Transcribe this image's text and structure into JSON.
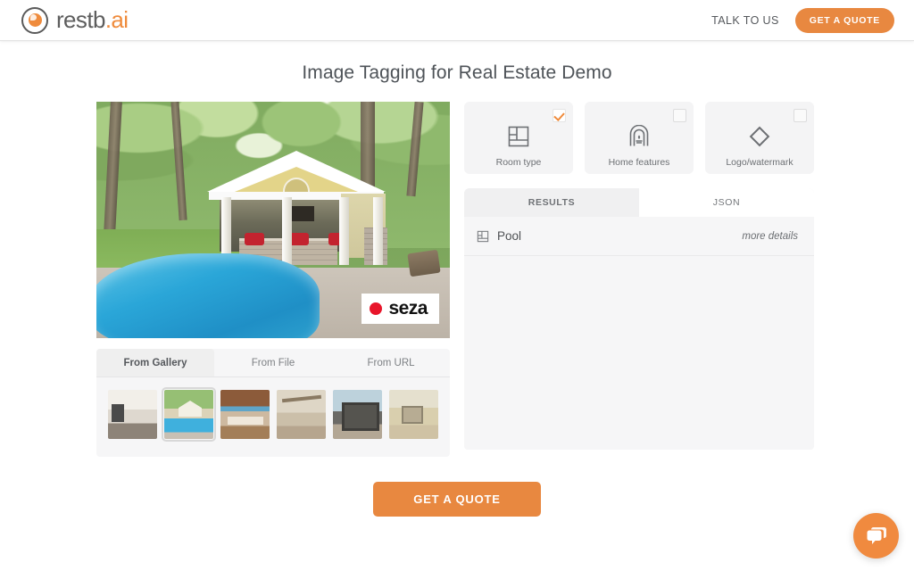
{
  "header": {
    "brand_name": "restb",
    "brand_suffix": ".ai",
    "talk_link": "TALK TO US",
    "quote_button": "GET A QUOTE"
  },
  "page": {
    "title": "Image Tagging for Real Estate Demo"
  },
  "hero": {
    "watermark_text": "seza"
  },
  "source": {
    "tabs": [
      {
        "label": "From Gallery",
        "active": true
      },
      {
        "label": "From File",
        "active": false
      },
      {
        "label": "From URL",
        "active": false
      }
    ],
    "thumbnails": [
      {
        "name": "living-room",
        "selected": false
      },
      {
        "name": "pool-pavilion",
        "selected": true
      },
      {
        "name": "kitchen",
        "selected": false
      },
      {
        "name": "dining-room",
        "selected": false
      },
      {
        "name": "hot-tub",
        "selected": false
      },
      {
        "name": "bedroom",
        "selected": false
      }
    ]
  },
  "models": [
    {
      "label": "Room type",
      "icon": "floorplan-icon",
      "checked": true
    },
    {
      "label": "Home features",
      "icon": "fireplace-icon",
      "checked": false
    },
    {
      "label": "Logo/watermark",
      "icon": "diamond-icon",
      "checked": false
    }
  ],
  "results": {
    "tabs": [
      {
        "label": "RESULTS",
        "selected": false
      },
      {
        "label": "JSON",
        "selected": true
      }
    ],
    "rows": [
      {
        "icon": "floorplan-icon",
        "label": "Pool",
        "more": "more details"
      }
    ]
  },
  "footer": {
    "cta_label": "GET A QUOTE"
  },
  "chat": {
    "icon": "chat-bubble-icon"
  },
  "colors": {
    "accent_orange": "#e88840",
    "panel_grey": "#f6f6f7",
    "text_grey": "#4e5358",
    "watermark_red": "#e8152a"
  }
}
